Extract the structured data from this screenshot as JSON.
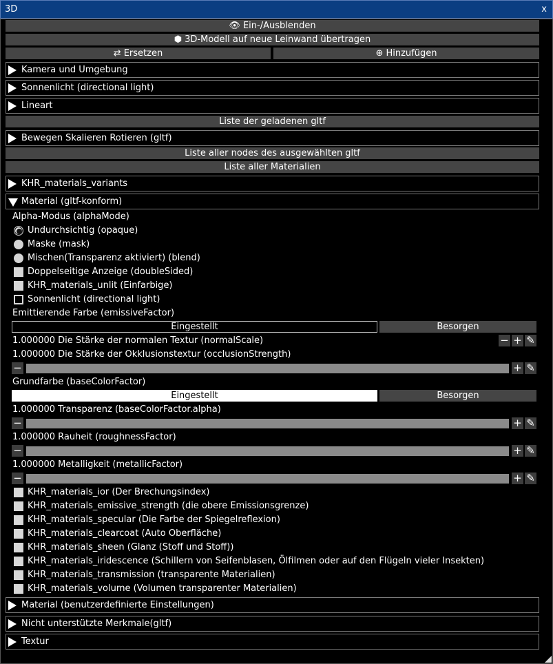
{
  "window": {
    "title": "3D",
    "close": "x"
  },
  "toolbar": {
    "show_hide": "Ein-/Ausblenden",
    "transfer": "3D-Modell auf neue Leinwand übertragen",
    "replace": "Ersetzen",
    "add": "Hinzufügen"
  },
  "sections": {
    "camera": "Kamera und Umgebung",
    "sunlight": "Sonnenlicht (directional light)",
    "lineart": "Lineart",
    "gltf_list": "Liste der geladenen gltf",
    "transform": "Bewegen Skalieren Rotieren (gltf)",
    "nodes_list": "Liste aller nodes des ausgewählten gltf",
    "materials_list": "Liste aller Materialien",
    "variants": "KHR_materials_variants",
    "material_gltf": "Material (gltf-konform)",
    "material_custom": "Material (benutzerdefinierte Einstellungen)",
    "unsupported": "Nicht unterstützte Merkmale(gltf)",
    "texture": "Textur"
  },
  "material": {
    "alpha_mode_label": "Alpha-Modus (alphaMode)",
    "alpha_opaque": "Undurchsichtig (opaque)",
    "alpha_mask": "Maske (mask)",
    "alpha_blend": "Mischen(Transparenz aktiviert) (blend)",
    "double_sided": "Doppelseitige Anzeige (doubleSided)",
    "unlit": "KHR_materials_unlit (Einfarbige)",
    "sunlight": "Sonnenlicht (directional light)",
    "emissive_label": "Emittierende Farbe (emissiveFactor)",
    "set_label": "Eingestellt",
    "get_label": "Besorgen",
    "normal_scale": "1.000000 Die Stärke der normalen Textur (normalScale)",
    "occlusion": "1.000000 Die Stärke der Okklusionstextur (occlusionStrength)",
    "base_color_label": "Grundfarbe (baseColorFactor)",
    "alpha": "1.000000 Transparenz (baseColorFactor.alpha)",
    "roughness": "1.000000 Rauheit (roughnessFactor)",
    "metallic": "1.000000 Metalligkeit (metallicFactor)",
    "ext_ior": "KHR_materials_ior (Der Brechungsindex)",
    "ext_emissive_strength": "KHR_materials_emissive_strength (die obere Emissionsgrenze)",
    "ext_specular": "KHR_materials_specular (Die Farbe der Spiegelreflexion)",
    "ext_clearcoat": "KHR_materials_clearcoat (Auto Oberfläche)",
    "ext_sheen": "KHR_materials_sheen (Glanz (Stoff und Stoff))",
    "ext_iridescence": "KHR_materials_iridescence (Schillern von Seifenblasen, Ölfilmen oder auf den Flügeln vieler Insekten)",
    "ext_transmission": "KHR_materials_transmission (transparente Materialien)",
    "ext_volume": "KHR_materials_volume (Volumen transparenter Materialien)"
  },
  "glyphs": {
    "minus": "−",
    "plus": "+",
    "edit": "✎",
    "eye": "👁",
    "cube": "⬢",
    "swap": "⇄",
    "add": "⊕"
  },
  "colors": {
    "titlebar": "#0b3e82",
    "button": "#454545",
    "slider": "#8a8a8a",
    "emissive_color": "#000000",
    "base_color": "#ffffff"
  }
}
